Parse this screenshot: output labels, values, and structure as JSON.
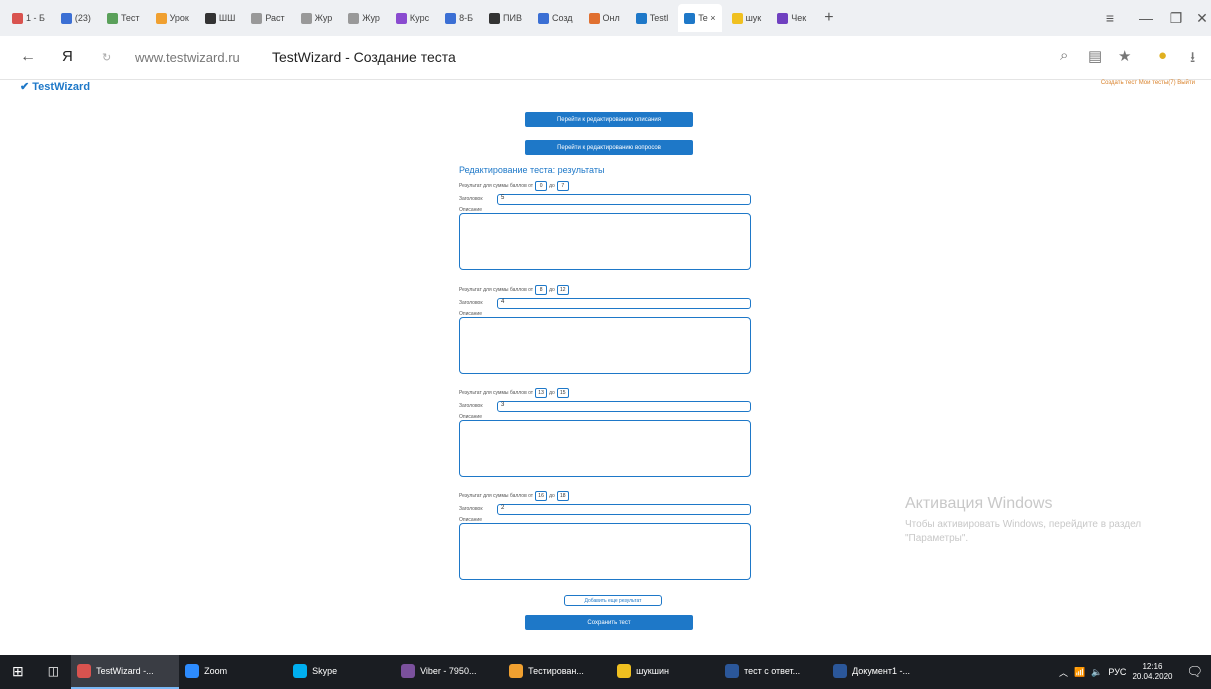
{
  "browser": {
    "tabs": [
      {
        "label": "1 - Б",
        "color": "#d9534f"
      },
      {
        "label": "(23)",
        "color": "#3b6fd4"
      },
      {
        "label": "Тест",
        "color": "#5aa05a"
      },
      {
        "label": "Урок",
        "color": "#f0a030"
      },
      {
        "label": "ШШ",
        "color": "#333"
      },
      {
        "label": "Раст",
        "color": "#999"
      },
      {
        "label": "Жур",
        "color": "#999"
      },
      {
        "label": "Жур",
        "color": "#999"
      },
      {
        "label": "Курс",
        "color": "#8a4bd0"
      },
      {
        "label": "8-Б",
        "color": "#3b6fd4"
      },
      {
        "label": "ПИВ",
        "color": "#333"
      },
      {
        "label": "Созд",
        "color": "#3b6fd4"
      },
      {
        "label": "Онл",
        "color": "#e07030"
      },
      {
        "label": "Testl",
        "color": "#1e78c8"
      },
      {
        "label": "Te ×",
        "color": "#1e78c8",
        "active": true
      },
      {
        "label": "шук",
        "color": "#f0c020"
      },
      {
        "label": "Чек",
        "color": "#7040c0"
      }
    ],
    "url": "www.testwizard.ru",
    "page_title": "TestWizard - Создание теста"
  },
  "site": {
    "logo": "✔ TestWizard",
    "top_links": "Создать тест   Мои тесты(7)   Выйти",
    "btn_edit_desc": "Перейти к редактированию описания",
    "btn_edit_questions": "Перейти к редактированию вопросов",
    "heading": "Редактирование теста: результаты",
    "range_prefix": "Результат для суммы баллов от",
    "range_to": "до",
    "header_label": "Заголовок",
    "desc_label": "Описание",
    "results": [
      {
        "from": "0",
        "to": "7",
        "header": "5"
      },
      {
        "from": "8",
        "to": "12",
        "header": "4"
      },
      {
        "from": "13",
        "to": "15",
        "header": "3"
      },
      {
        "from": "16",
        "to": "18",
        "header": "2"
      }
    ],
    "add_result": "Добавить еще результат",
    "save": "Сохранить тест"
  },
  "watermark": {
    "title": "Активация Windows",
    "text": "Чтобы активировать Windows, перейдите в раздел \"Параметры\"."
  },
  "taskbar": {
    "items": [
      {
        "label": "TestWizard -...",
        "color": "#d9534f",
        "active": true
      },
      {
        "label": "Zoom",
        "color": "#2d8cff"
      },
      {
        "label": "Skype",
        "color": "#00aff0"
      },
      {
        "label": "Viber - 7950...",
        "color": "#7b519d"
      },
      {
        "label": "Тестирован...",
        "color": "#f0a030"
      },
      {
        "label": "шукшин",
        "color": "#f0c020"
      },
      {
        "label": "тест с ответ...",
        "color": "#2b579a"
      },
      {
        "label": "Документ1 -...",
        "color": "#2b579a"
      }
    ],
    "lang": "РУС",
    "time": "12:16",
    "date": "20.04.2020"
  }
}
